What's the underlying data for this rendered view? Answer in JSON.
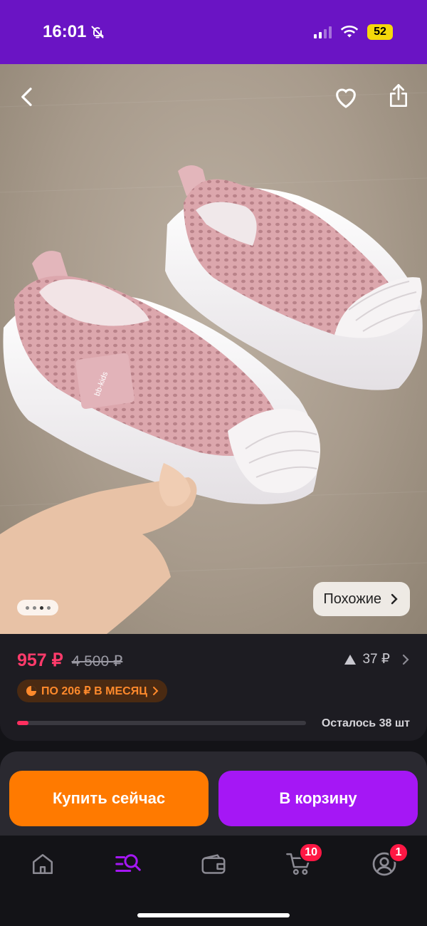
{
  "status_bar": {
    "time": "16:01",
    "battery": "52"
  },
  "product": {
    "image_alt": "pink knit baby shoes with white shell toe",
    "logo_text": "bb-kids",
    "gallery_pages": 4,
    "gallery_active": 3,
    "similar_label": "Похожие"
  },
  "price": {
    "current": "957 ₽",
    "old": "4 500 ₽",
    "delta": "37 ₽",
    "installment": "ПО 206 ₽ В МЕСЯЦ",
    "stock_fraction": 0.04,
    "remaining": "Осталось 38 шт"
  },
  "actions": {
    "buy_now": "Купить сейчас",
    "add_to_cart": "В корзину"
  },
  "tab_bar": {
    "items": [
      "home",
      "catalog",
      "wallet",
      "cart",
      "profile"
    ],
    "active": "catalog",
    "cart_badge": "10",
    "profile_badge": "1"
  },
  "colors": {
    "status_bar": "#6a14c4",
    "price_accent": "#ff3b6b",
    "buy": "#ff7a00",
    "cart": "#a517f5",
    "active_tab": "#a517f5"
  }
}
